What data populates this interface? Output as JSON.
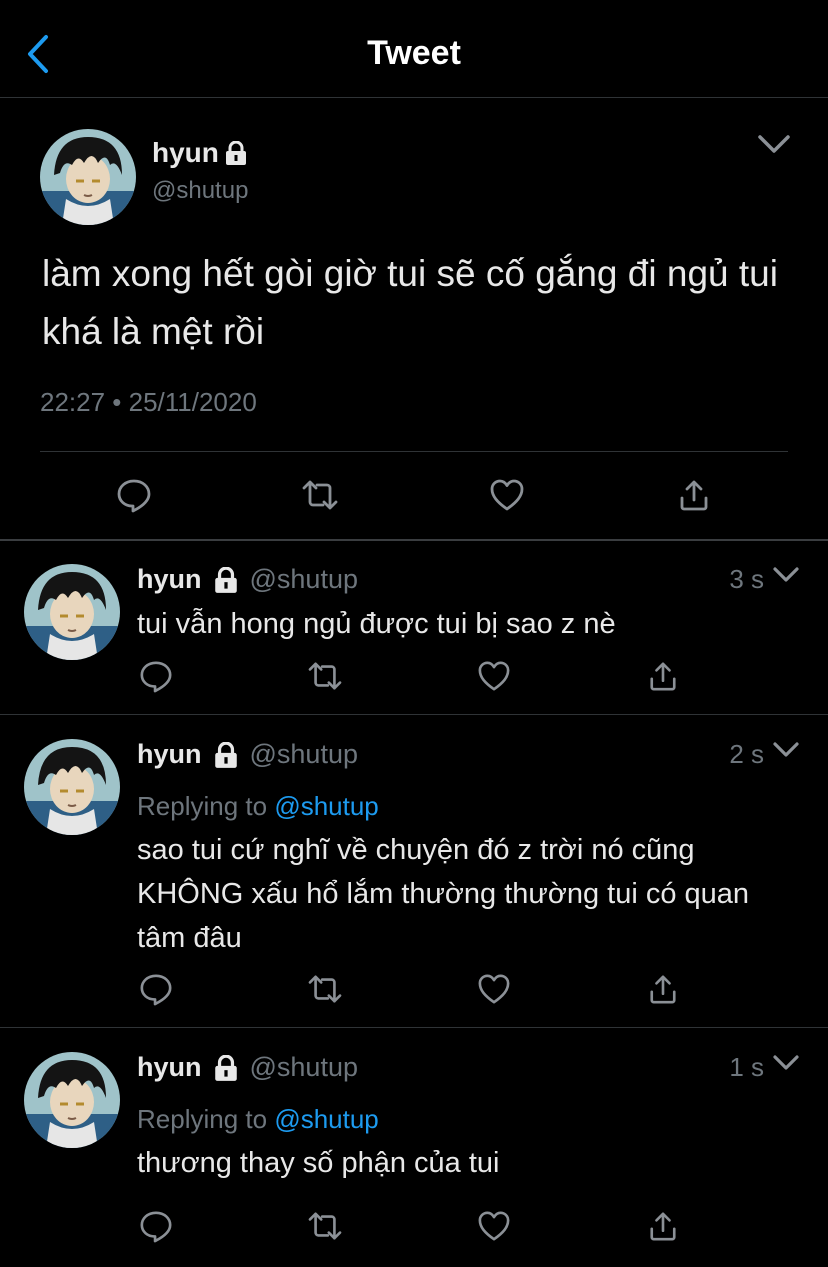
{
  "header": {
    "title": "Tweet",
    "back_icon": "chevron-left-icon"
  },
  "main_tweet": {
    "name": "hyun",
    "handle": "@shutup",
    "text": "làm xong hết gòi giờ tui sẽ cố gắng đi ngủ tui khá là mệt rồi",
    "timestamp": "22:27 • 25/11/2020",
    "protected_icon": "lock-icon"
  },
  "replies": [
    {
      "name": "hyun",
      "handle": "@shutup",
      "time": "3 s",
      "replying_prefix": "",
      "replying_to": "",
      "text": "tui vẫn hong ngủ được tui bị sao z nè"
    },
    {
      "name": "hyun",
      "handle": "@shutup",
      "time": "2 s",
      "replying_prefix": "Replying to ",
      "replying_to": "@shutup",
      "text": "sao tui cứ nghĩ về chuyện đó z trời nó cũng KHÔNG xấu hổ lắm thường thường tui có quan tâm đâu"
    },
    {
      "name": "hyun",
      "handle": "@shutup",
      "time": "1 s",
      "replying_prefix": "Replying to ",
      "replying_to": "@shutup",
      "text": "thương thay số phận của tui"
    }
  ],
  "colors": {
    "background": "#000000",
    "text_primary": "#e8e8e8",
    "text_secondary": "#6e767d",
    "accent": "#1d9bf0",
    "divider": "#2f3336"
  }
}
